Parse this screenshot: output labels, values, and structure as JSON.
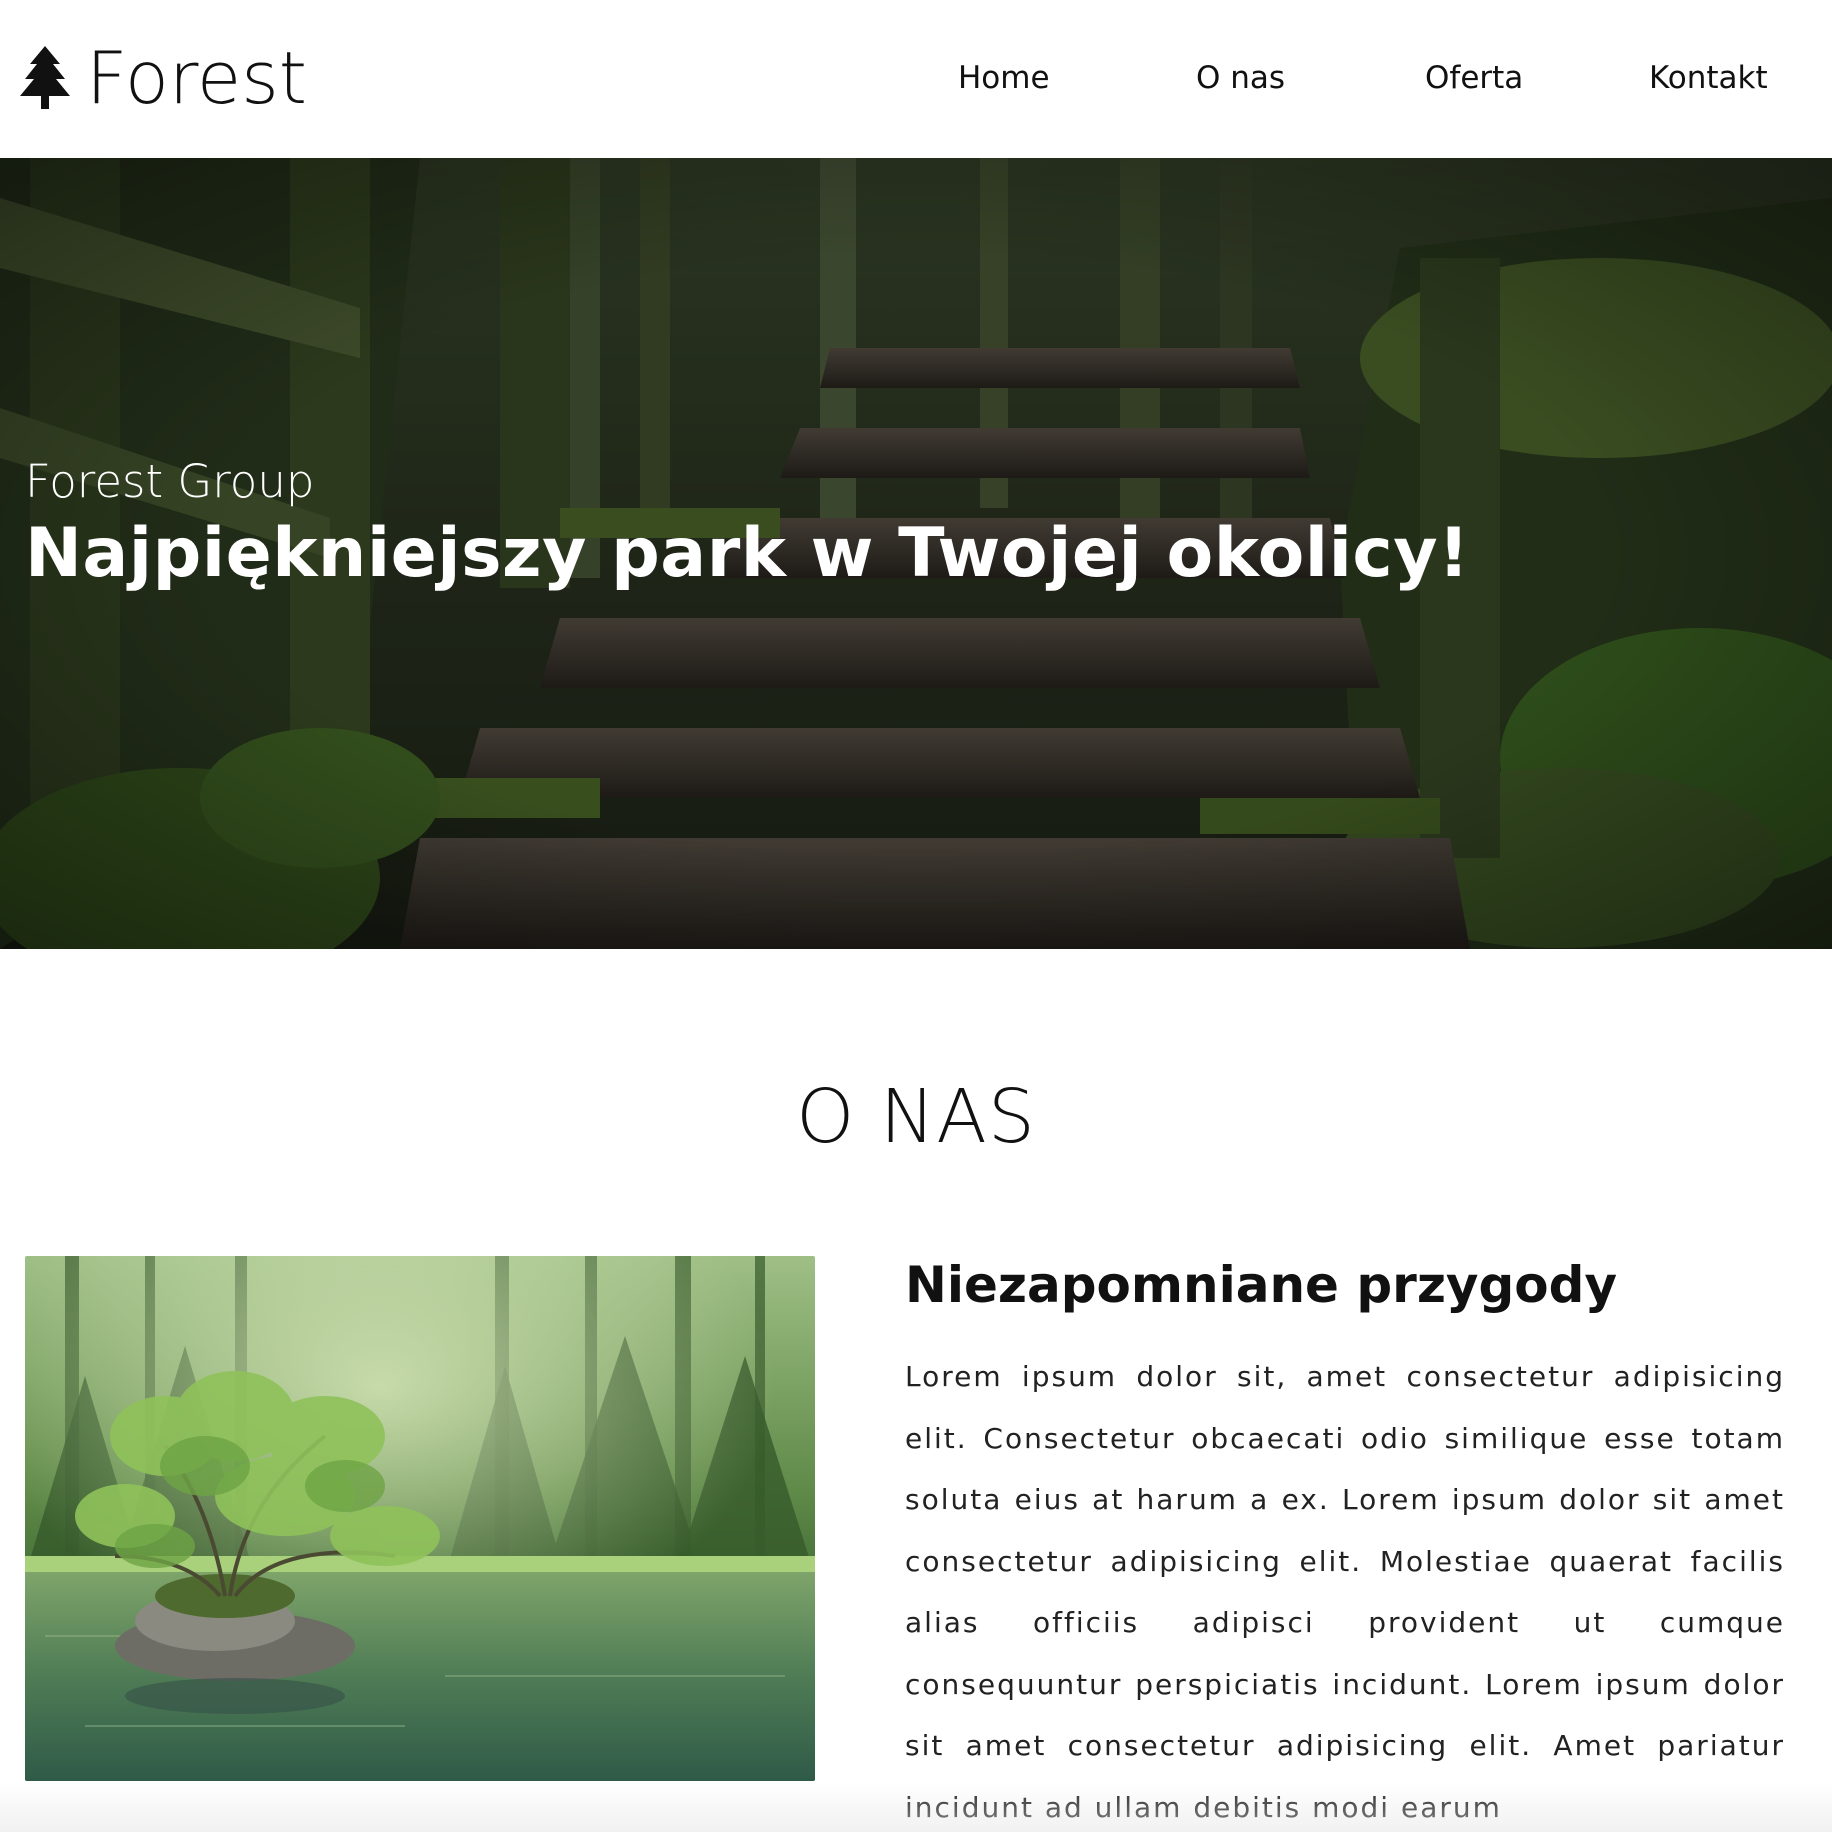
{
  "header": {
    "logo_text": "Forest",
    "logo_icon": "tree-icon",
    "nav": [
      {
        "label": "Home"
      },
      {
        "label": "O nas"
      },
      {
        "label": "Oferta"
      },
      {
        "label": "Kontakt"
      }
    ]
  },
  "hero": {
    "subtitle": "Forest Group",
    "title": "Najpiękniejszy park w Twojej okolicy!",
    "image": "forest-boardwalk-stairs"
  },
  "about": {
    "section_title": "O NAS",
    "image": "tree-on-rock-in-lake",
    "heading": "Niezapomniane przygody",
    "text": "Lorem ipsum dolor sit, amet consectetur adipisicing elit. Consectetur obcaecati odio similique esse totam soluta eius at harum a ex. Lorem ipsum dolor sit amet consectetur adipisicing elit. Molestiae quaerat facilis alias officiis adipisci provident ut cumque consequuntur perspiciatis incidunt. Lorem ipsum dolor sit amet consectetur adipisicing elit. Amet pariatur incidunt ad ullam debitis modi earum"
  },
  "colors": {
    "text": "#111111",
    "hero_text": "#ffffff",
    "background": "#ffffff"
  }
}
